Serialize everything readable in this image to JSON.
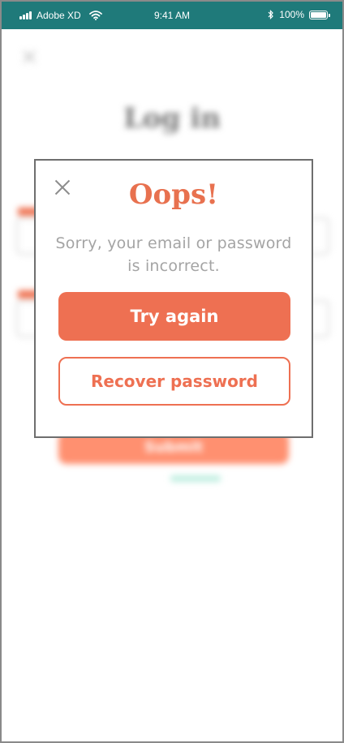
{
  "status_bar": {
    "carrier": "Adobe XD",
    "time": "9:41 AM",
    "battery": "100%"
  },
  "background_screen": {
    "title": "Log in",
    "submit_label": "Submit"
  },
  "dialog": {
    "title": "Oops!",
    "message": "Sorry, your email or password is incorrect.",
    "primary_button": "Try again",
    "secondary_button": "Recover password"
  },
  "colors": {
    "status_bar": "#1f7a7a",
    "accent": "#ee7052",
    "message_text": "#a4a4a4"
  },
  "icons": [
    "signal-icon",
    "wifi-icon",
    "bluetooth-icon",
    "battery-icon",
    "close-icon"
  ]
}
